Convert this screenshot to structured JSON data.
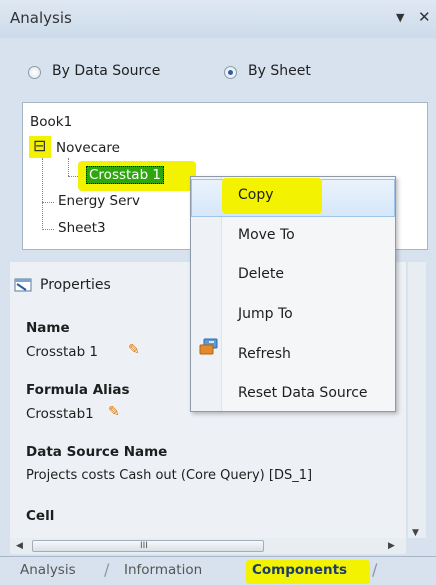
{
  "window": {
    "title": "Analysis",
    "pin_icon": "dropdown-arrow-icon",
    "close_icon": "close-icon"
  },
  "view_mode": {
    "options": [
      {
        "label": "By Data Source",
        "selected": false
      },
      {
        "label": "By Sheet",
        "selected": true
      }
    ]
  },
  "tree": {
    "root": "Book1",
    "nodes": [
      {
        "label": "Novecare",
        "expander": "⊟"
      },
      {
        "label": "Crosstab 1"
      },
      {
        "label": "Energy Serv"
      },
      {
        "label": "Sheet3"
      }
    ]
  },
  "properties": {
    "header": "Properties",
    "fields": [
      {
        "label": "Name",
        "value": "Crosstab 1"
      },
      {
        "label": "Formula Alias",
        "value": "Crosstab1"
      },
      {
        "label": "Data Source Name",
        "value": "Projects costs  Cash out (Core Query) [DS_1]"
      },
      {
        "label": "Cell",
        "value": ""
      }
    ]
  },
  "context_menu": {
    "items": [
      {
        "label": "Copy",
        "hovered": true
      },
      {
        "label": "Move To"
      },
      {
        "label": "Delete"
      },
      {
        "label": "Jump To"
      },
      {
        "label": "Refresh",
        "icon": "refresh-icon"
      },
      {
        "label": "Reset Data Source"
      }
    ]
  },
  "scroll": {
    "h_grip": "III"
  },
  "tabs": [
    {
      "label": "Analysis",
      "active": false
    },
    {
      "label": "Information",
      "active": false
    },
    {
      "label": "Components",
      "active": true
    }
  ],
  "colors": {
    "highlight_yellow": "#f3f200",
    "selected_node": "#2ea70f",
    "panel_bg": "#d7e2ee"
  }
}
